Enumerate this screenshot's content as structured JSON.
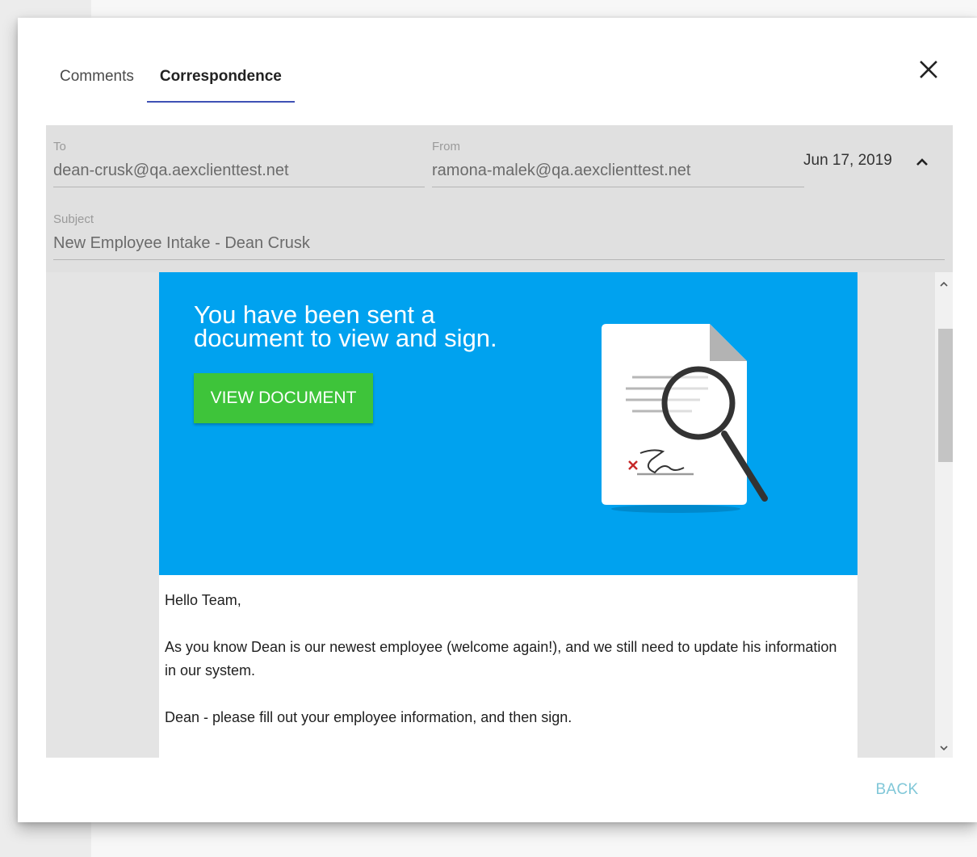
{
  "tabs": [
    {
      "label": "Comments",
      "active": false
    },
    {
      "label": "Correspondence",
      "active": true
    }
  ],
  "close_icon": "close-icon",
  "message": {
    "to_label": "To",
    "to_value": "dean-crusk@qa.aexclienttest.net",
    "from_label": "From",
    "from_value": "ramona-malek@qa.aexclienttest.net",
    "date": "Jun 17, 2019",
    "subject_label": "Subject",
    "subject_value": "New Employee Intake - Dean Crusk"
  },
  "email": {
    "banner_title": "You have been sent a document to view and sign.",
    "view_button": "VIEW DOCUMENT",
    "banner_color": "#00a2ef",
    "button_color": "#3ec43a",
    "greeting": "Hello Team,",
    "paragraph_1": "As you know Dean is our newest employee (welcome again!), and we still need to update his information in our system.",
    "paragraph_2": "Dean - please fill out your employee information, and then sign."
  },
  "footer": {
    "back_label": "BACK"
  },
  "colors": {
    "tab_indicator": "#3f51b5",
    "back_button": "#80c7d8"
  }
}
